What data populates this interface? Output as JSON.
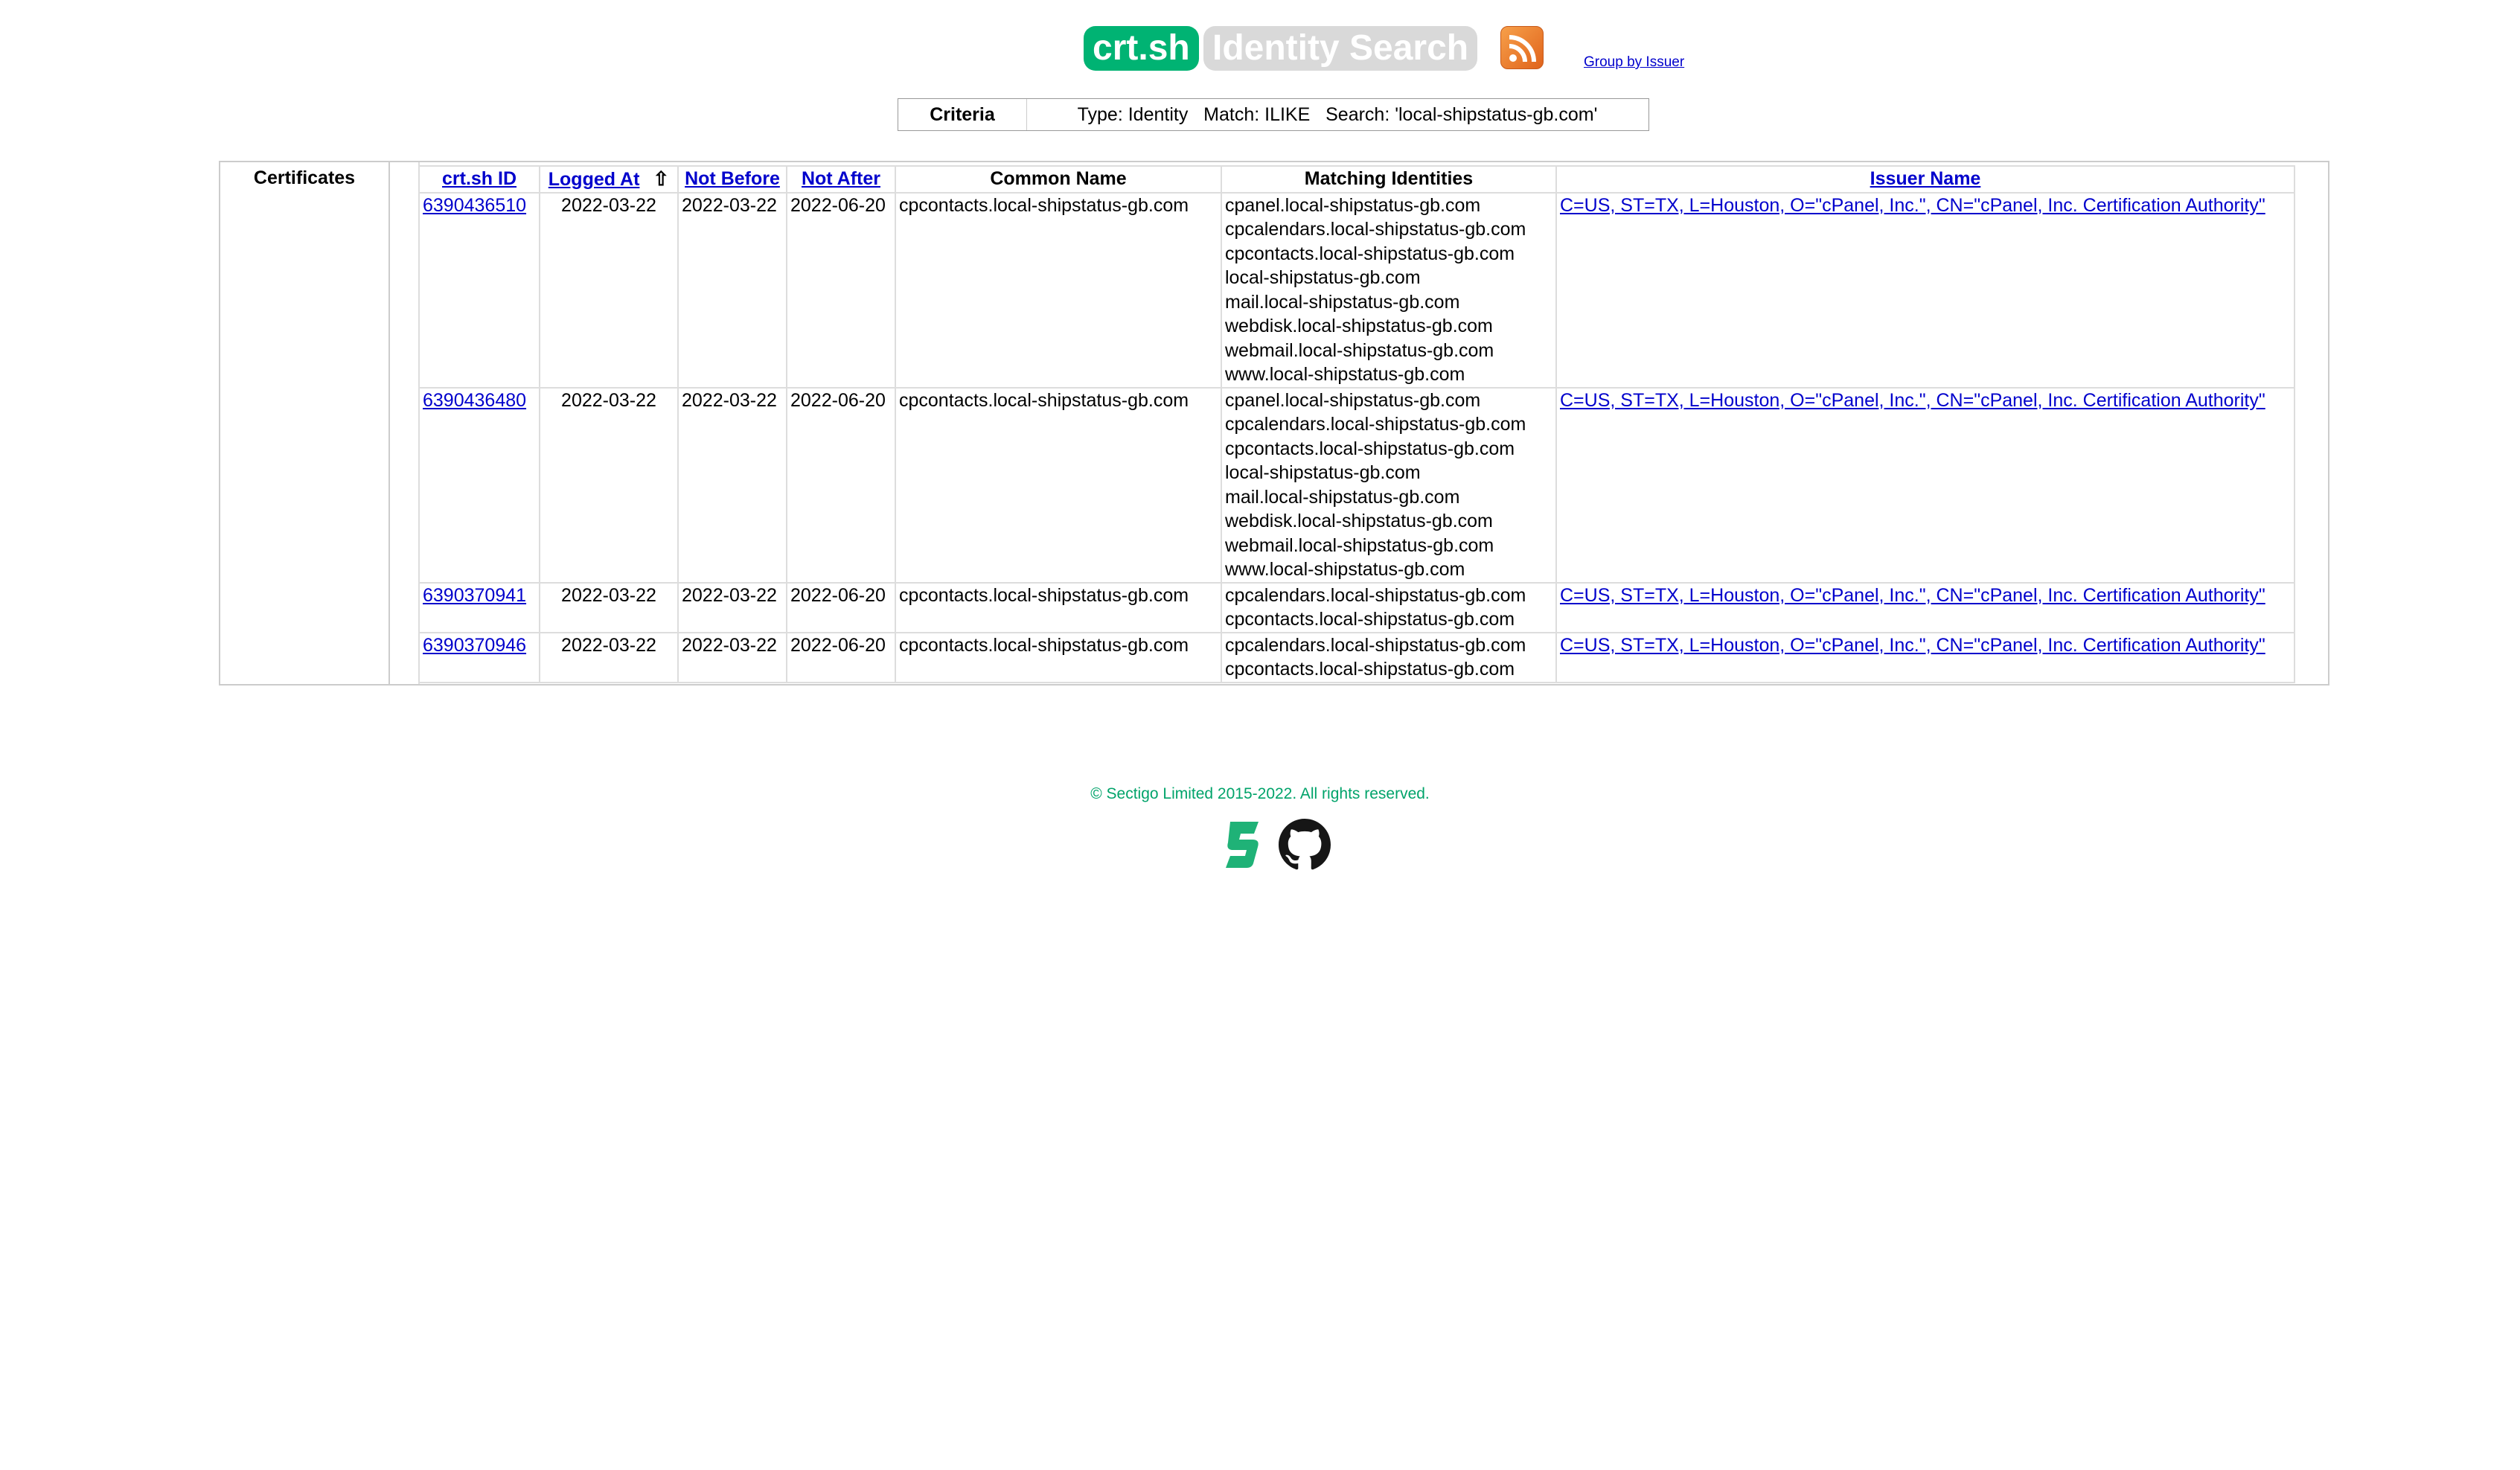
{
  "header": {
    "logo_text": "crt.sh",
    "title": "Identity Search",
    "rss_icon": "rss-feed-icon",
    "group_link": "Group by Issuer",
    "colors": {
      "logo_bg": "#00b373",
      "title_bg": "#d9d9d9",
      "link": "#0000cc"
    }
  },
  "criteria": {
    "label": "Criteria",
    "text": "Type: Identity   Match: ILIKE   Search: 'local-shipstatus-gb.com'"
  },
  "certificates": {
    "label": "Certificates",
    "columns": [
      "crt.sh ID",
      "Logged At",
      "Not Before",
      "Not After",
      "Common Name",
      "Matching Identities",
      "Issuer Name"
    ],
    "sort_indicator": "⇧",
    "rows": [
      {
        "id": "6390436510",
        "logged_at": "2022-03-22",
        "not_before": "2022-03-22",
        "not_after": "2022-06-20",
        "common_name": "cpcontacts.local-shipstatus-gb.com",
        "identities": [
          "cpanel.local-shipstatus-gb.com",
          "cpcalendars.local-shipstatus-gb.com",
          "cpcontacts.local-shipstatus-gb.com",
          "local-shipstatus-gb.com",
          "mail.local-shipstatus-gb.com",
          "webdisk.local-shipstatus-gb.com",
          "webmail.local-shipstatus-gb.com",
          "www.local-shipstatus-gb.com"
        ],
        "issuer": "C=US, ST=TX, L=Houston, O=\"cPanel, Inc.\", CN=\"cPanel, Inc. Certification Authority\""
      },
      {
        "id": "6390436480",
        "logged_at": "2022-03-22",
        "not_before": "2022-03-22",
        "not_after": "2022-06-20",
        "common_name": "cpcontacts.local-shipstatus-gb.com",
        "identities": [
          "cpanel.local-shipstatus-gb.com",
          "cpcalendars.local-shipstatus-gb.com",
          "cpcontacts.local-shipstatus-gb.com",
          "local-shipstatus-gb.com",
          "mail.local-shipstatus-gb.com",
          "webdisk.local-shipstatus-gb.com",
          "webmail.local-shipstatus-gb.com",
          "www.local-shipstatus-gb.com"
        ],
        "issuer": "C=US, ST=TX, L=Houston, O=\"cPanel, Inc.\", CN=\"cPanel, Inc. Certification Authority\""
      },
      {
        "id": "6390370941",
        "logged_at": "2022-03-22",
        "not_before": "2022-03-22",
        "not_after": "2022-06-20",
        "common_name": "cpcontacts.local-shipstatus-gb.com",
        "identities": [
          "cpcalendars.local-shipstatus-gb.com",
          "cpcontacts.local-shipstatus-gb.com"
        ],
        "issuer": "C=US, ST=TX, L=Houston, O=\"cPanel, Inc.\", CN=\"cPanel, Inc. Certification Authority\""
      },
      {
        "id": "6390370946",
        "logged_at": "2022-03-22",
        "not_before": "2022-03-22",
        "not_after": "2022-06-20",
        "common_name": "cpcontacts.local-shipstatus-gb.com",
        "identities": [
          "cpcalendars.local-shipstatus-gb.com",
          "cpcontacts.local-shipstatus-gb.com"
        ],
        "issuer": "C=US, ST=TX, L=Houston, O=\"cPanel, Inc.\", CN=\"cPanel, Inc. Certification Authority\""
      }
    ]
  },
  "footer": {
    "copyright": "© Sectigo Limited 2015-2022. All rights reserved.",
    "icons": [
      "sectigo-logo-icon",
      "github-icon"
    ],
    "colors": {
      "copyright": "#00a36a",
      "sectigo": "#1fb277"
    }
  }
}
